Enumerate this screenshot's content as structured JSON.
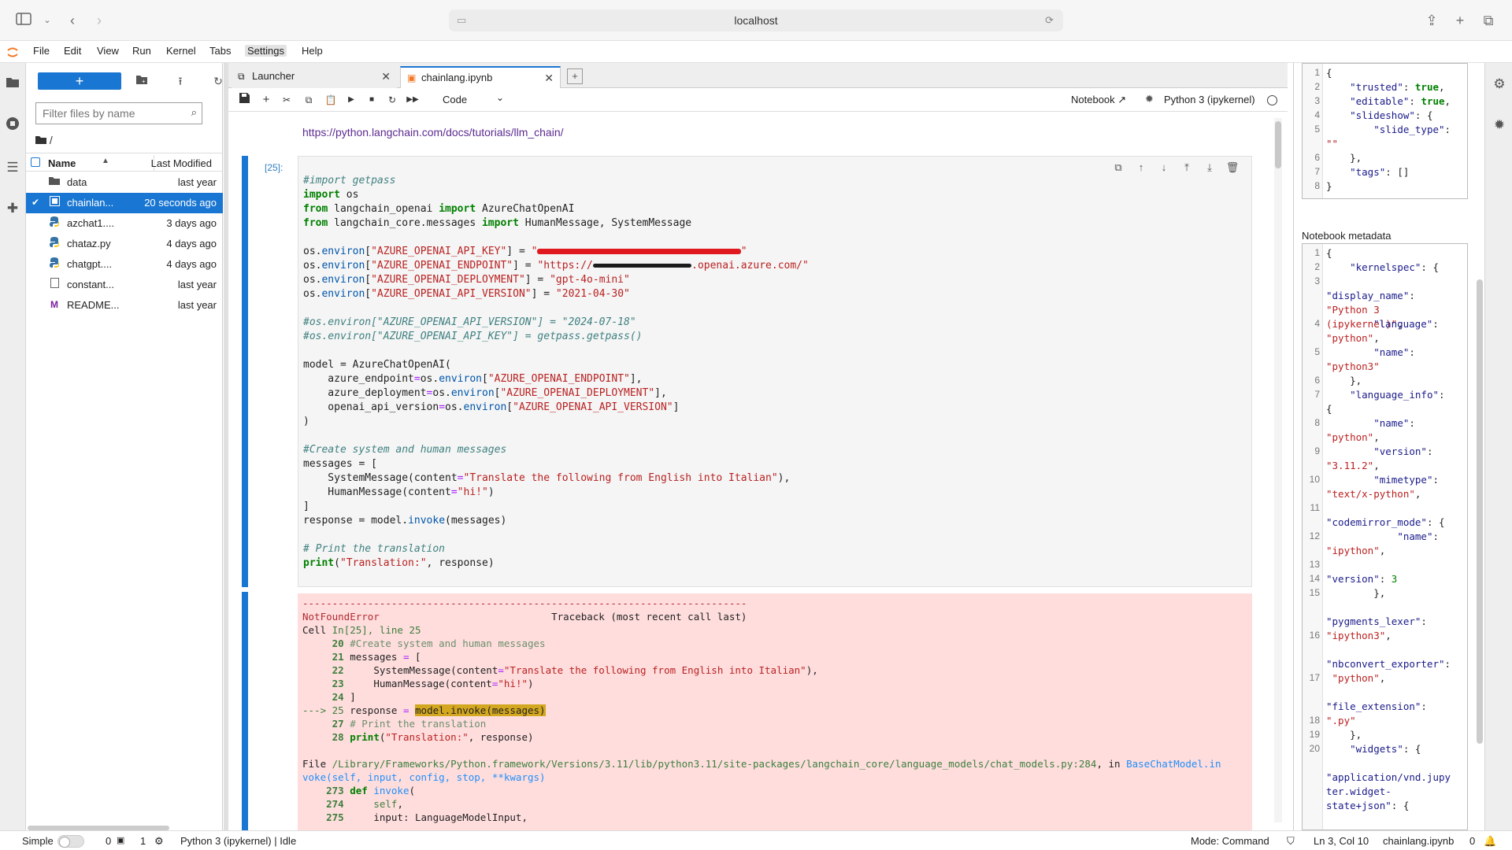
{
  "browser": {
    "url": "localhost"
  },
  "menu": {
    "items": [
      "File",
      "Edit",
      "View",
      "Run",
      "Kernel",
      "Tabs",
      "Settings",
      "Help"
    ],
    "active": "Settings"
  },
  "file_browser": {
    "new_label": "+",
    "filter_placeholder": "Filter files by name",
    "breadcrumb": "/",
    "col_name": "Name",
    "col_modified": "Last Modified",
    "files": [
      {
        "name": "data",
        "modified": "last year",
        "icon": "folder-icon",
        "selected": false
      },
      {
        "name": "chainlan...",
        "modified": "20 seconds ago",
        "icon": "notebook-icon",
        "selected": true
      },
      {
        "name": "azchat1....",
        "modified": "3 days ago",
        "icon": "python-icon",
        "selected": false
      },
      {
        "name": "chataz.py",
        "modified": "4 days ago",
        "icon": "python-icon",
        "selected": false
      },
      {
        "name": "chatgpt....",
        "modified": "4 days ago",
        "icon": "python-icon",
        "selected": false
      },
      {
        "name": "constant...",
        "modified": "last year",
        "icon": "file-icon",
        "selected": false
      },
      {
        "name": "README...",
        "modified": "last year",
        "icon": "markdown-icon",
        "selected": false
      }
    ]
  },
  "tabs": [
    {
      "label": "Launcher"
    },
    {
      "label": "chainlang.ipynb"
    }
  ],
  "toolbar": {
    "cell_type": "Code",
    "notebook_label": "Notebook",
    "kernel": "Python 3 (ipykernel)"
  },
  "notebook": {
    "link": "https://python.langchain.com/docs/tutorials/llm_chain/",
    "prompt": "[25]:"
  },
  "inspector": {
    "nb_metadata_label": "Notebook metadata"
  },
  "status": {
    "mode_label": "Simple",
    "count1": "0",
    "count2": "1",
    "kernel_status": "Python 3 (ipykernel) | Idle",
    "mode": "Mode: Command",
    "position": "Ln 3, Col 10",
    "filename": "chainlang.ipynb",
    "notifications": "0"
  },
  "colors": {
    "accent": "#1976d2",
    "error_bg": "#ffdddd"
  }
}
